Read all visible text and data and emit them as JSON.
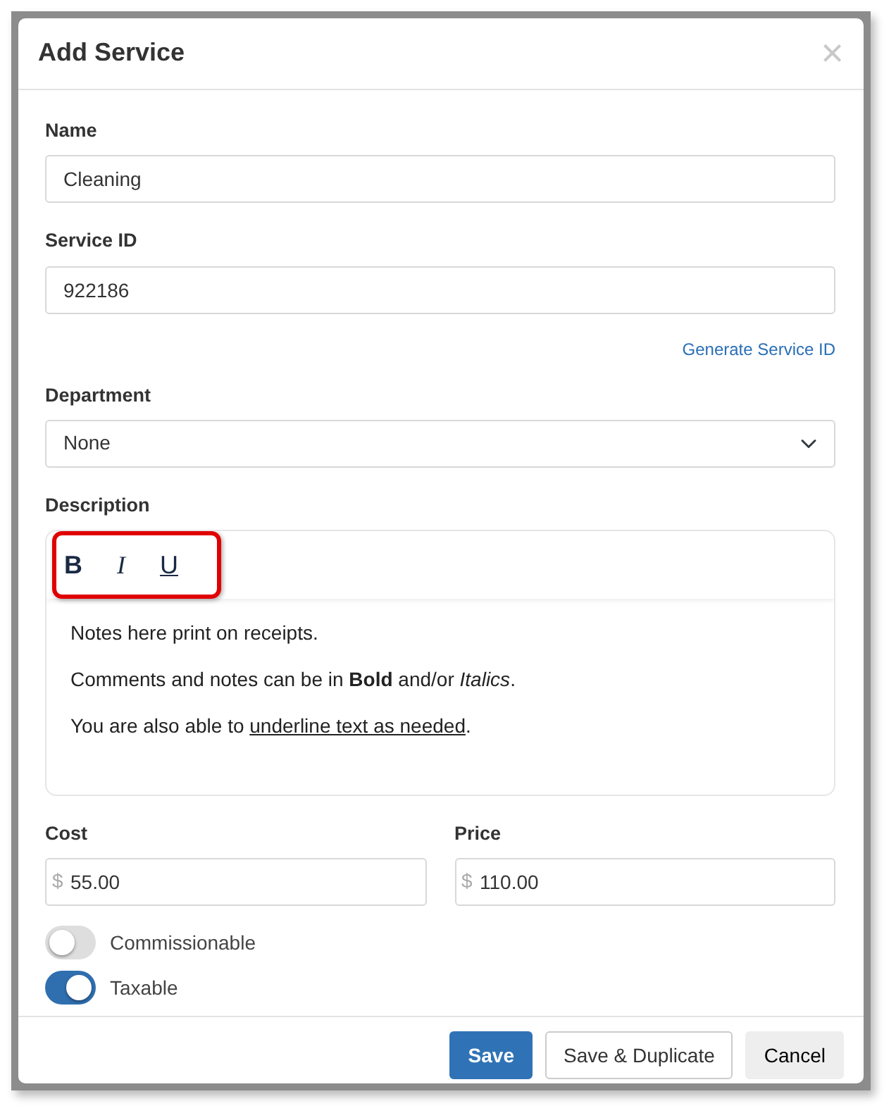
{
  "dialog": {
    "title": "Add Service",
    "close": "×"
  },
  "fields": [
    {
      "kind": "text",
      "label": "Name",
      "value": "Cleaning"
    },
    {
      "kind": "text",
      "label": "Service ID",
      "value": "922186",
      "link": "Generate Service ID"
    },
    {
      "kind": "select",
      "label": "Department",
      "value": "None"
    }
  ],
  "description": {
    "label": "Description",
    "toolbar": [
      {
        "kind": "bold",
        "label": "B"
      },
      {
        "kind": "italic",
        "label": "I"
      },
      {
        "kind": "underline",
        "label": "U"
      }
    ],
    "highlighted": true,
    "paragraphs": [
      "Notes here print on receipts.",
      "Comments and notes can be in **Bold** and/or *Italics*.",
      [
        {
          "text": "You are also able to "
        },
        {
          "text": "underline text as needed",
          "underline": true
        },
        {
          "text": "."
        }
      ]
    ]
  },
  "money": [
    {
      "label": "Cost",
      "prefix": "$",
      "value": "55.00"
    },
    {
      "label": "Price",
      "prefix": "$",
      "value": "110.00"
    }
  ],
  "toggles": [
    {
      "label": "Commissionable",
      "on": false
    },
    {
      "label": "Taxable",
      "on": true
    }
  ],
  "buttons": [
    {
      "kind": "primary",
      "label": "Save"
    },
    {
      "kind": "outline",
      "label": "Save & Duplicate"
    },
    {
      "kind": "light",
      "label": "Cancel"
    }
  ]
}
